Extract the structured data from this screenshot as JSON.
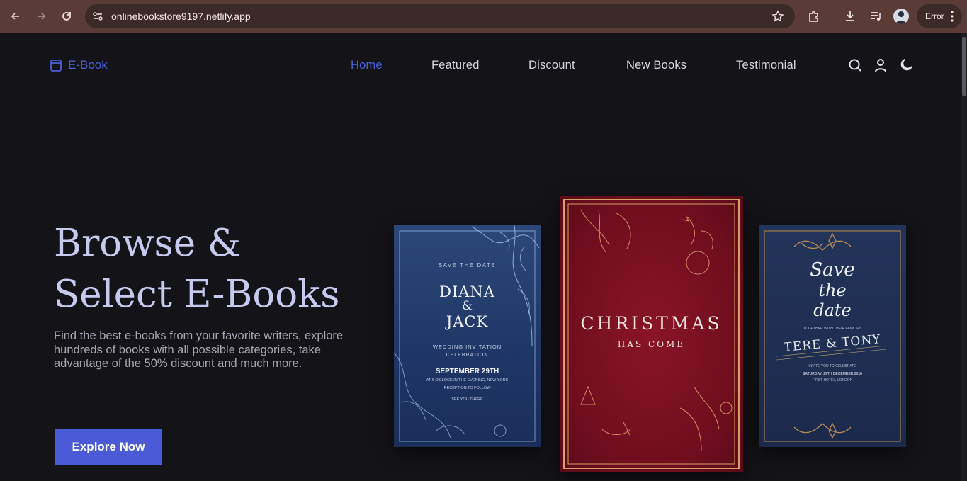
{
  "browser": {
    "url": "onlinebookstore9197.netlify.app",
    "error_label": "Error"
  },
  "site": {
    "logo": "E-Book",
    "nav": [
      "Home",
      "Featured",
      "Discount",
      "New Books",
      "Testimonial"
    ],
    "active_nav": "Home",
    "accent_color": "#4b5ad6",
    "hero": {
      "title_line1": "Browse &",
      "title_line2": "Select E-Books",
      "description": "Find the best e-books from your favorite writers, explore hundreds of books with all possible categories, take advantage of the 50% discount and much more.",
      "cta": "Explore Now"
    },
    "books": [
      {
        "top": "SAVE THE DATE",
        "names": [
          "DIANA",
          "&",
          "JACK"
        ],
        "subtitle": "WEDDING INVITATION",
        "subtitle2": "CELEBRATION",
        "date": "SEPTEMBER 29TH",
        "line1": "AT 6 O'CLOCK IN THE EVENING, NEW YORK",
        "line2": "RECEPTION TO FOLLOW",
        "line3": "SEE YOU THERE"
      },
      {
        "title": "CHRISTMAS",
        "subtitle": "HAS COME"
      },
      {
        "script_line1": "Save",
        "script_line2": "the",
        "script_line3": "date",
        "small1": "TOGETHER WITH THEIR FAMILIES",
        "names": "TERE & TONY",
        "small2": "INVITE YOU TO CELEBRATE",
        "small3": "SATURDAY, 29TH DECEMBER 2018",
        "small4": "FIRST HOTEL, LONDON"
      }
    ]
  }
}
